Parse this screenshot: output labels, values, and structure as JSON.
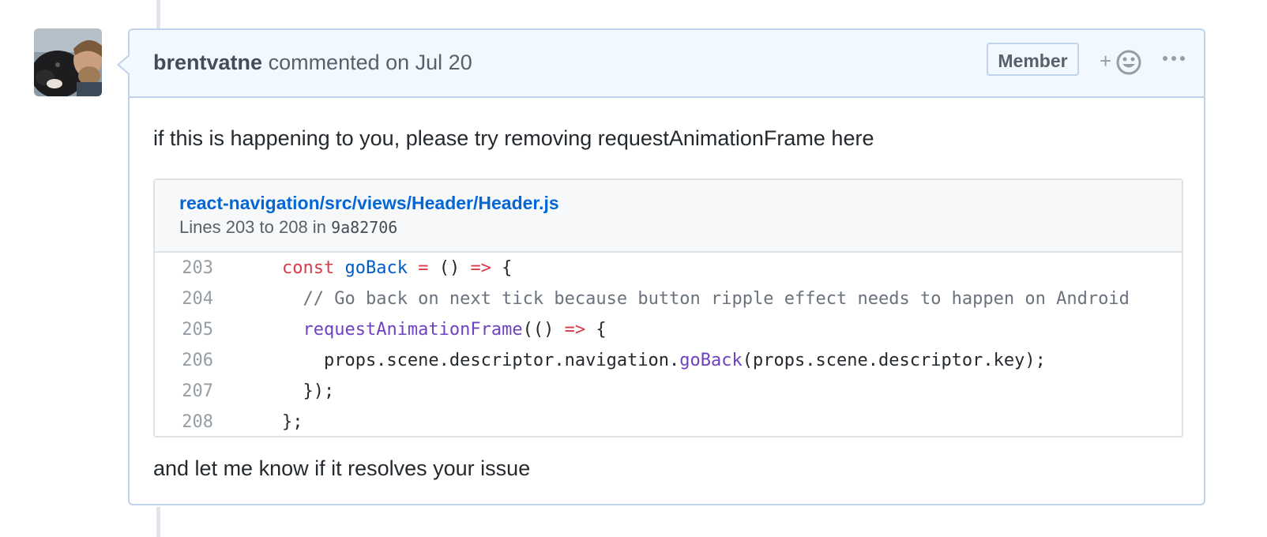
{
  "comment": {
    "author": "brentvatne",
    "action": "commented on Jul 20",
    "badge": "Member",
    "reaction_plus": "+",
    "body_paragraph_1": "if this is happening to you, please try removing requestAnimationFrame here",
    "body_paragraph_2": "and let me know if it resolves your issue"
  },
  "embed": {
    "file_path": "react-navigation/src/views/Header/Header.js",
    "lines_prefix": "Lines 203 to 208 in",
    "commit": "9a82706",
    "lines": [
      {
        "num": "203",
        "tokens": [
          {
            "t": "    ",
            "c": ""
          },
          {
            "t": "const",
            "c": "kw"
          },
          {
            "t": " ",
            "c": ""
          },
          {
            "t": "goBack",
            "c": "fn"
          },
          {
            "t": " ",
            "c": ""
          },
          {
            "t": "=",
            "c": "kw"
          },
          {
            "t": " () ",
            "c": ""
          },
          {
            "t": "=>",
            "c": "kw"
          },
          {
            "t": " {",
            "c": ""
          }
        ]
      },
      {
        "num": "204",
        "tokens": [
          {
            "t": "      ",
            "c": ""
          },
          {
            "t": "// Go back on next tick because button ripple effect needs to happen on Android",
            "c": "cm"
          }
        ]
      },
      {
        "num": "205",
        "tokens": [
          {
            "t": "      ",
            "c": ""
          },
          {
            "t": "requestAnimationFrame",
            "c": "fn2"
          },
          {
            "t": "(() ",
            "c": ""
          },
          {
            "t": "=>",
            "c": "kw"
          },
          {
            "t": " {",
            "c": ""
          }
        ]
      },
      {
        "num": "206",
        "tokens": [
          {
            "t": "        props.scene.descriptor.navigation.",
            "c": ""
          },
          {
            "t": "goBack",
            "c": "fn2"
          },
          {
            "t": "(props.scene.descriptor.key);",
            "c": ""
          }
        ]
      },
      {
        "num": "207",
        "tokens": [
          {
            "t": "      });",
            "c": ""
          }
        ]
      },
      {
        "num": "208",
        "tokens": [
          {
            "t": "    };",
            "c": ""
          }
        ]
      }
    ]
  },
  "icons": {
    "avatar": "user-avatar",
    "reaction": "smiley-icon",
    "more": "kebab-horizontal-icon"
  },
  "colors": {
    "header_bg": "#f1f8ff",
    "border": "#c0d3eb",
    "link": "#0366d6",
    "keyword": "#d73a49",
    "function": "#005cc5",
    "method": "#6f42c1",
    "comment": "#6a737d"
  }
}
